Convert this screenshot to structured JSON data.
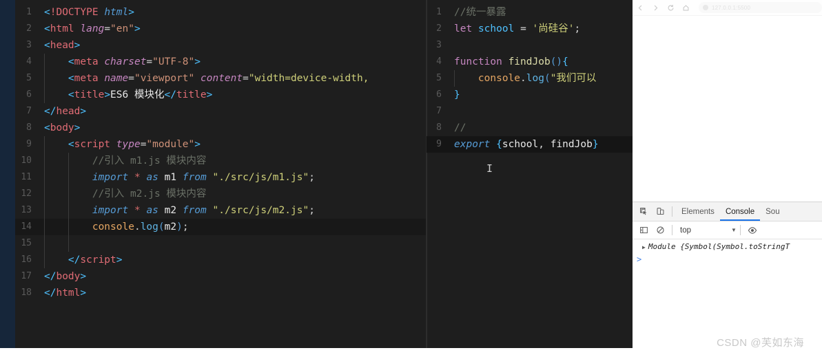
{
  "browser": {
    "nav": {
      "back_icon": "arrow-left-icon",
      "forward_icon": "arrow-right-icon",
      "reload_icon": "reload-icon",
      "home_icon": "home-icon"
    },
    "url_bar": {
      "lock_icon": "info-circle-icon",
      "url_text": "127.0.0.1:5500"
    }
  },
  "editor": {
    "left_pane": {
      "language": "html",
      "active_line": 14,
      "lines": [
        {
          "no": "1",
          "indent": 0,
          "tokens": [
            {
              "c": "t-punct",
              "t": "<"
            },
            {
              "c": "t-tag",
              "t": "!DOCTYPE "
            },
            {
              "c": "t-kw",
              "t": "html"
            },
            {
              "c": "t-punct",
              "t": ">"
            }
          ]
        },
        {
          "no": "2",
          "indent": 0,
          "tokens": [
            {
              "c": "t-punct",
              "t": "<"
            },
            {
              "c": "t-tag",
              "t": "html "
            },
            {
              "c": "t-attr",
              "t": "lang"
            },
            {
              "c": "t-op",
              "t": "="
            },
            {
              "c": "t-str",
              "t": "\"en\""
            },
            {
              "c": "t-punct",
              "t": ">"
            }
          ]
        },
        {
          "no": "3",
          "indent": 0,
          "tokens": [
            {
              "c": "t-punct",
              "t": "<"
            },
            {
              "c": "t-tag",
              "t": "head"
            },
            {
              "c": "t-punct",
              "t": ">"
            }
          ]
        },
        {
          "no": "4",
          "indent": 1,
          "tokens": [
            {
              "c": "t-text",
              "t": "    "
            },
            {
              "c": "t-punct",
              "t": "<"
            },
            {
              "c": "t-tag",
              "t": "meta "
            },
            {
              "c": "t-attr",
              "t": "charset"
            },
            {
              "c": "t-op",
              "t": "="
            },
            {
              "c": "t-str",
              "t": "\"UTF-8\""
            },
            {
              "c": "t-punct",
              "t": ">"
            }
          ]
        },
        {
          "no": "5",
          "indent": 1,
          "tokens": [
            {
              "c": "t-text",
              "t": "    "
            },
            {
              "c": "t-punct",
              "t": "<"
            },
            {
              "c": "t-tag",
              "t": "meta "
            },
            {
              "c": "t-attr",
              "t": "name"
            },
            {
              "c": "t-op",
              "t": "="
            },
            {
              "c": "t-str",
              "t": "\"viewport\""
            },
            {
              "c": "t-text",
              "t": " "
            },
            {
              "c": "t-attr",
              "t": "content"
            },
            {
              "c": "t-op",
              "t": "="
            },
            {
              "c": "t-str2",
              "t": "\"width=device-width,"
            }
          ]
        },
        {
          "no": "6",
          "indent": 1,
          "tokens": [
            {
              "c": "t-text",
              "t": "    "
            },
            {
              "c": "t-punct",
              "t": "<"
            },
            {
              "c": "t-tag",
              "t": "title"
            },
            {
              "c": "t-punct",
              "t": ">"
            },
            {
              "c": "t-white",
              "t": "ES6 模块化"
            },
            {
              "c": "t-punct",
              "t": "</"
            },
            {
              "c": "t-tag",
              "t": "title"
            },
            {
              "c": "t-punct",
              "t": ">"
            }
          ]
        },
        {
          "no": "7",
          "indent": 0,
          "tokens": [
            {
              "c": "t-punct",
              "t": "</"
            },
            {
              "c": "t-tag",
              "t": "head"
            },
            {
              "c": "t-punct",
              "t": ">"
            }
          ]
        },
        {
          "no": "8",
          "indent": 0,
          "tokens": [
            {
              "c": "t-punct",
              "t": "<"
            },
            {
              "c": "t-tag",
              "t": "body"
            },
            {
              "c": "t-punct",
              "t": ">"
            }
          ]
        },
        {
          "no": "9",
          "indent": 1,
          "tokens": [
            {
              "c": "t-text",
              "t": "    "
            },
            {
              "c": "t-punct",
              "t": "<"
            },
            {
              "c": "t-tag",
              "t": "script "
            },
            {
              "c": "t-attr",
              "t": "type"
            },
            {
              "c": "t-op",
              "t": "="
            },
            {
              "c": "t-str",
              "t": "\"module\""
            },
            {
              "c": "t-punct",
              "t": ">"
            }
          ]
        },
        {
          "no": "10",
          "indent": 2,
          "tokens": [
            {
              "c": "t-text",
              "t": "        "
            },
            {
              "c": "t-comment",
              "t": "//引入 m1.js 模块内容"
            }
          ]
        },
        {
          "no": "11",
          "indent": 2,
          "tokens": [
            {
              "c": "t-text",
              "t": "        "
            },
            {
              "c": "t-kw",
              "t": "import"
            },
            {
              "c": "t-text",
              "t": " "
            },
            {
              "c": "t-star",
              "t": "*"
            },
            {
              "c": "t-text",
              "t": " "
            },
            {
              "c": "t-kw",
              "t": "as"
            },
            {
              "c": "t-text",
              "t": " "
            },
            {
              "c": "t-white",
              "t": "m1"
            },
            {
              "c": "t-text",
              "t": " "
            },
            {
              "c": "t-kw",
              "t": "from"
            },
            {
              "c": "t-text",
              "t": " "
            },
            {
              "c": "t-str2",
              "t": "\"./src/js/m1.js\""
            },
            {
              "c": "t-op",
              "t": ";"
            }
          ]
        },
        {
          "no": "12",
          "indent": 2,
          "tokens": [
            {
              "c": "t-text",
              "t": "        "
            },
            {
              "c": "t-comment",
              "t": "//引入 m2.js 模块内容"
            }
          ]
        },
        {
          "no": "13",
          "indent": 2,
          "tokens": [
            {
              "c": "t-text",
              "t": "        "
            },
            {
              "c": "t-kw",
              "t": "import"
            },
            {
              "c": "t-text",
              "t": " "
            },
            {
              "c": "t-star",
              "t": "*"
            },
            {
              "c": "t-text",
              "t": " "
            },
            {
              "c": "t-kw",
              "t": "as"
            },
            {
              "c": "t-text",
              "t": " "
            },
            {
              "c": "t-white",
              "t": "m2"
            },
            {
              "c": "t-text",
              "t": " "
            },
            {
              "c": "t-kw",
              "t": "from"
            },
            {
              "c": "t-text",
              "t": " "
            },
            {
              "c": "t-str2",
              "t": "\"./src/js/m2.js\""
            },
            {
              "c": "t-op",
              "t": ";"
            }
          ]
        },
        {
          "no": "14",
          "indent": 2,
          "hl": true,
          "tokens": [
            {
              "c": "t-text",
              "t": "        "
            },
            {
              "c": "t-obj",
              "t": "console"
            },
            {
              "c": "t-text",
              "t": "."
            },
            {
              "c": "t-prop",
              "t": "log"
            },
            {
              "c": "t-paren",
              "t": "("
            },
            {
              "c": "t-white",
              "t": "m2"
            },
            {
              "c": "t-paren",
              "t": ")"
            },
            {
              "c": "t-op",
              "t": ";"
            }
          ]
        },
        {
          "no": "15",
          "indent": 2,
          "tokens": []
        },
        {
          "no": "16",
          "indent": 1,
          "tokens": [
            {
              "c": "t-text",
              "t": "    "
            },
            {
              "c": "t-punct",
              "t": "</"
            },
            {
              "c": "t-tag",
              "t": "script"
            },
            {
              "c": "t-punct",
              "t": ">"
            }
          ]
        },
        {
          "no": "17",
          "indent": 0,
          "tokens": [
            {
              "c": "t-punct",
              "t": "</"
            },
            {
              "c": "t-tag",
              "t": "body"
            },
            {
              "c": "t-punct",
              "t": ">"
            }
          ]
        },
        {
          "no": "18",
          "indent": 0,
          "tokens": [
            {
              "c": "t-punct",
              "t": "</"
            },
            {
              "c": "t-tag",
              "t": "html"
            },
            {
              "c": "t-punct",
              "t": ">"
            }
          ]
        }
      ]
    },
    "right_pane": {
      "language": "javascript",
      "active_line": 9,
      "lines": [
        {
          "no": "1",
          "indent": 0,
          "tokens": [
            {
              "c": "t-comment",
              "t": "//统一暴露"
            }
          ]
        },
        {
          "no": "2",
          "indent": 0,
          "tokens": [
            {
              "c": "t-kw2",
              "t": "let"
            },
            {
              "c": "t-text",
              "t": " "
            },
            {
              "c": "t-blue",
              "t": "school"
            },
            {
              "c": "t-text",
              "t": " "
            },
            {
              "c": "t-op",
              "t": "="
            },
            {
              "c": "t-text",
              "t": " "
            },
            {
              "c": "t-str2",
              "t": "'尚硅谷'"
            },
            {
              "c": "t-op",
              "t": ";"
            }
          ]
        },
        {
          "no": "3",
          "indent": 0,
          "tokens": []
        },
        {
          "no": "4",
          "indent": 0,
          "tokens": [
            {
              "c": "t-kw2",
              "t": "function"
            },
            {
              "c": "t-text",
              "t": " "
            },
            {
              "c": "t-fn",
              "t": "findJob"
            },
            {
              "c": "t-paren",
              "t": "()"
            },
            {
              "c": "t-punct",
              "t": "{"
            }
          ]
        },
        {
          "no": "5",
          "indent": 1,
          "tokens": [
            {
              "c": "t-text",
              "t": "    "
            },
            {
              "c": "t-obj",
              "t": "console"
            },
            {
              "c": "t-text",
              "t": "."
            },
            {
              "c": "t-prop",
              "t": "log"
            },
            {
              "c": "t-paren",
              "t": "("
            },
            {
              "c": "t-str2",
              "t": "\"我们可以"
            }
          ]
        },
        {
          "no": "6",
          "indent": 0,
          "tokens": [
            {
              "c": "t-punct",
              "t": "}"
            }
          ]
        },
        {
          "no": "7",
          "indent": 0,
          "tokens": []
        },
        {
          "no": "8",
          "indent": 0,
          "tokens": [
            {
              "c": "t-comment",
              "t": "//"
            }
          ]
        },
        {
          "no": "9",
          "indent": 0,
          "hl": true,
          "tokens": [
            {
              "c": "t-kw",
              "t": "export"
            },
            {
              "c": "t-text",
              "t": " "
            },
            {
              "c": "t-punct",
              "t": "{"
            },
            {
              "c": "t-white",
              "t": "school"
            },
            {
              "c": "t-op",
              "t": ", "
            },
            {
              "c": "t-white",
              "t": "findJob"
            },
            {
              "c": "t-punct",
              "t": "}"
            }
          ]
        }
      ]
    }
  },
  "devtools": {
    "toolbar_icons": {
      "inspect": "inspect-element-icon",
      "device": "device-toolbar-icon"
    },
    "tabs": [
      {
        "label": "Elements",
        "active": false
      },
      {
        "label": "Console",
        "active": true
      },
      {
        "label": "Sou",
        "active": false
      }
    ],
    "console_toolbar": {
      "sidebar_icon": "console-sidebar-icon",
      "clear_icon": "clear-console-icon",
      "context": "top",
      "dropdown_icon": "chevron-down-icon",
      "eye_icon": "eye-icon"
    },
    "console_output": [
      {
        "disclosure_icon": "triangle-right-icon",
        "text": "Module {Symbol(Symbol.toStringT"
      }
    ],
    "prompt_symbol": ">"
  },
  "watermark": {
    "text": "CSDN @芙如东海"
  }
}
